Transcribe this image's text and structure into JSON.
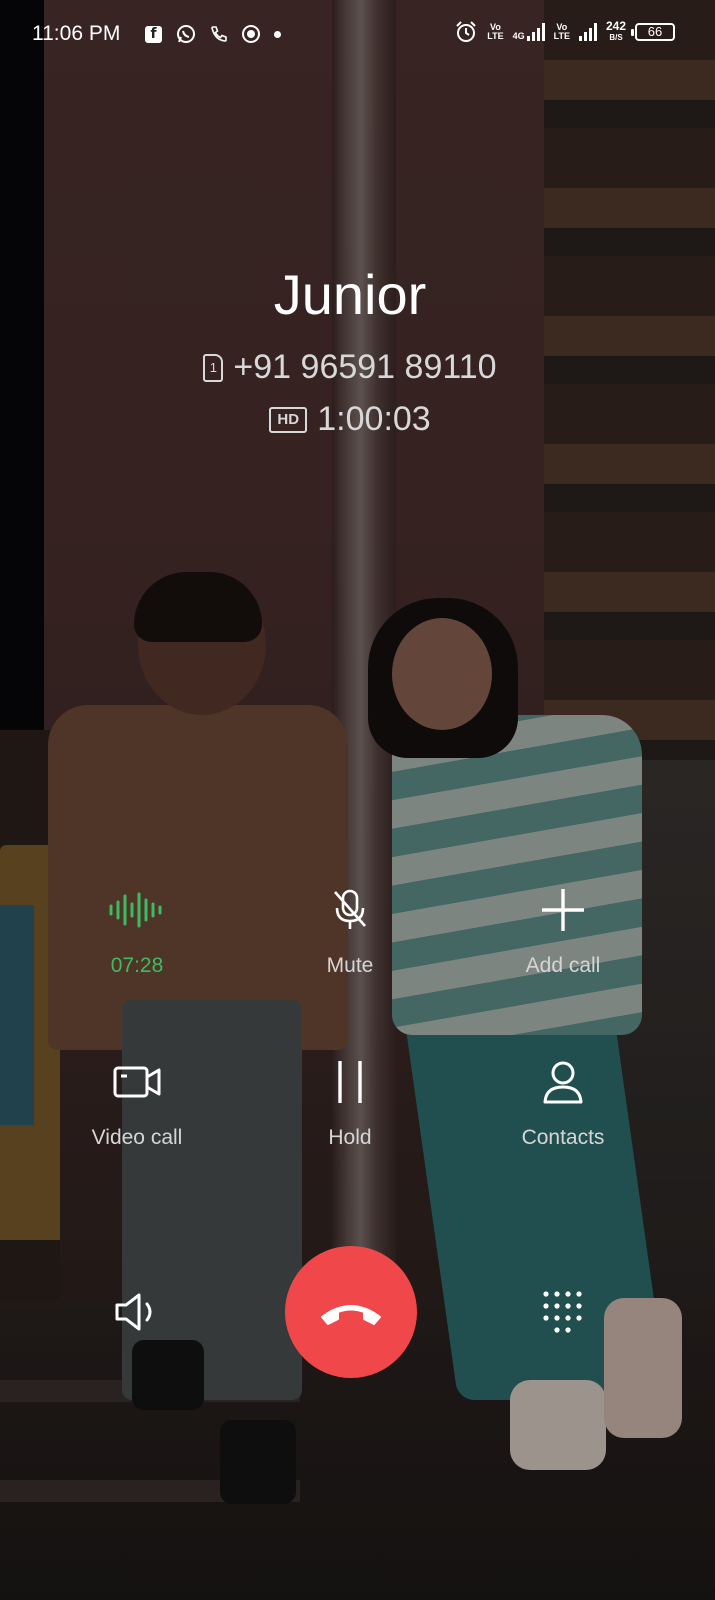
{
  "status_bar": {
    "time": "11:06 PM",
    "fb_glyph": "f",
    "volte_label": "Vo\nLTE",
    "net_4g": "4G",
    "speed_value": "242",
    "speed_unit": "B/S",
    "battery": "66"
  },
  "caller": {
    "name": "Junior",
    "sim_slot": "1",
    "number": "+91 96591 89110",
    "hd_label": "HD",
    "duration": "1:00:03"
  },
  "controls": {
    "recording": {
      "label": "07:28",
      "icon": "sound-wave-icon",
      "color": "#3dbb63"
    },
    "mute": {
      "label": "Mute",
      "icon": "mic-off-icon"
    },
    "add_call": {
      "label": "Add call",
      "icon": "plus-icon"
    },
    "video_call": {
      "label": "Video call",
      "icon": "video-camera-icon"
    },
    "hold": {
      "label": "Hold",
      "icon": "pause-icon"
    },
    "contacts": {
      "label": "Contacts",
      "icon": "person-icon"
    }
  },
  "bottom": {
    "speaker_icon": "speaker-icon",
    "end_call_icon": "phone-hangup-icon",
    "end_call_color": "#f0484a",
    "keypad_icon": "dialpad-icon"
  }
}
